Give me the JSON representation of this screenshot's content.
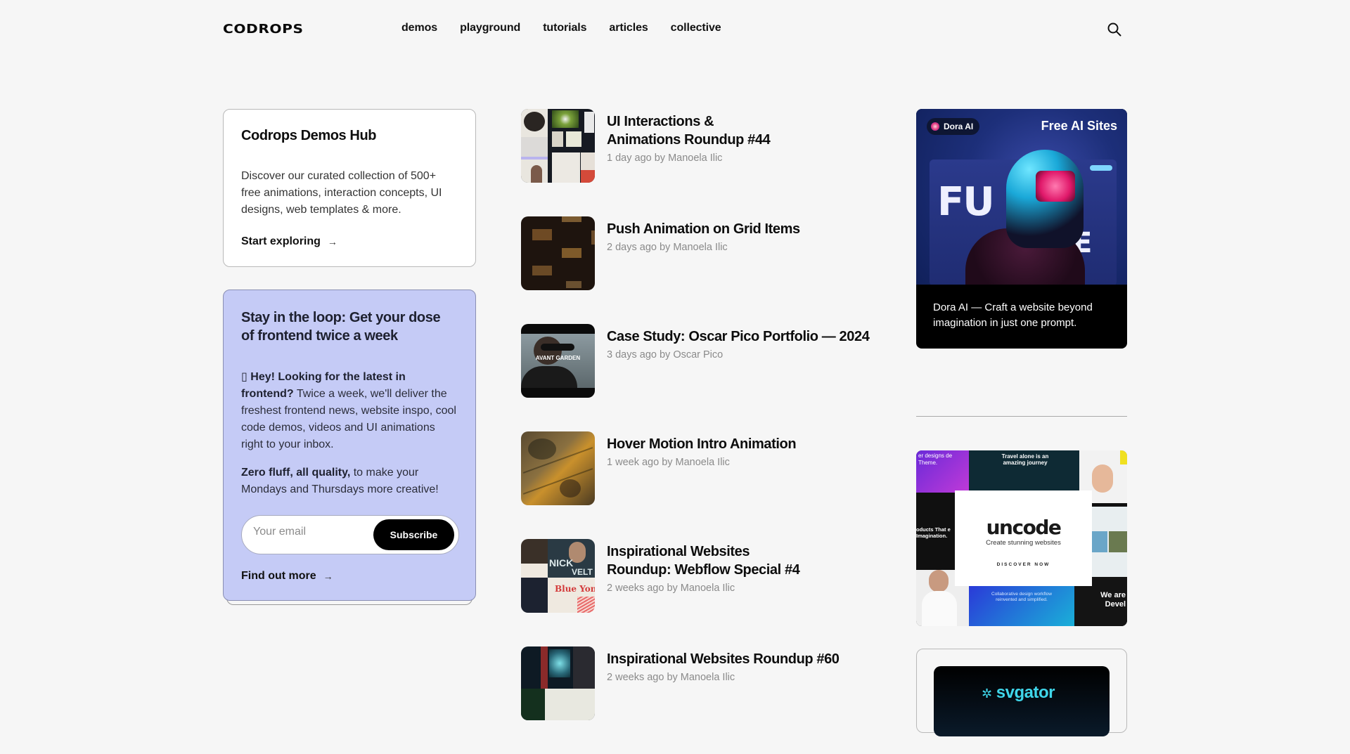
{
  "header": {
    "logo": "CODROPS",
    "nav": [
      "demos",
      "playground",
      "tutorials",
      "articles",
      "collective"
    ],
    "search_icon": "search-icon"
  },
  "hub_card": {
    "title": "Codrops Demos Hub",
    "description": "Discover our curated collection of 500+ free animations, interaction concepts, UI designs, web templates & more.",
    "link_label": "Start exploring",
    "arrow": "→"
  },
  "newsletter": {
    "title": "Stay in the loop: Get your dose of frontend twice a week",
    "p1_icon": "▯",
    "p1_bold": "Hey! Looking for the latest in frontend?",
    "p1_rest": " Twice a week, we'll deliver the freshest frontend news, website inspo, cool code demos, videos and UI animations right to your inbox.",
    "p2_bold": "Zero fluff, all quality,",
    "p2_rest": " to make your Mondays and Thursdays more creative!",
    "email_placeholder": "Your email",
    "email_value": "",
    "subscribe_label": "Subscribe",
    "link_label": "Find out more",
    "arrow": "→"
  },
  "articles": [
    {
      "title": "UI Interactions & Animations Roundup #44",
      "meta": "1 day ago by Manoela Ilic"
    },
    {
      "title": "Push Animation on Grid Items",
      "meta": "2 days ago by Manoela Ilic"
    },
    {
      "title": "Case Study: Oscar Pico Portfolio — 2024",
      "meta": "3 days ago by Oscar Pico",
      "thumb_text": "AVANT GARDEN"
    },
    {
      "title": "Hover Motion Intro Animation",
      "meta": "1 week ago by Manoela Ilic"
    },
    {
      "title": "Inspirational Websites Roundup: Webflow Special #4",
      "meta": "2 weeks ago by Manoela Ilic",
      "thumb_text_1": "NICK",
      "thumb_text_2": "VELT",
      "thumb_text_3": "Blue Yond"
    },
    {
      "title": "Inspirational Websites Roundup #60",
      "meta": "2 weeks ago by Manoela Ilic"
    }
  ],
  "ads": {
    "dora": {
      "badge": "Dora AI",
      "headline": "Free AI Sites",
      "big_text_1": "FU",
      "big_text_2": "R'E",
      "caption": "Dora AI — Craft a website beyond imagination in just one prompt."
    },
    "uncode": {
      "logo": "uncode",
      "subtitle": "Create stunning websites",
      "cta": "DISCOVER NOW",
      "tile_texts": [
        "er designs de Theme.",
        "Travel alone is an amazing journey",
        "oducts That e Imagination.",
        "Collaborative design workflow reinvented and simplified.",
        "We are Devel"
      ]
    },
    "svgator": {
      "logo": "svgator"
    }
  },
  "colors": {
    "background": "#f6f6f6",
    "newsletter_bg": "#c5cbf6",
    "text": "#111111",
    "meta": "#8a8a8a"
  }
}
